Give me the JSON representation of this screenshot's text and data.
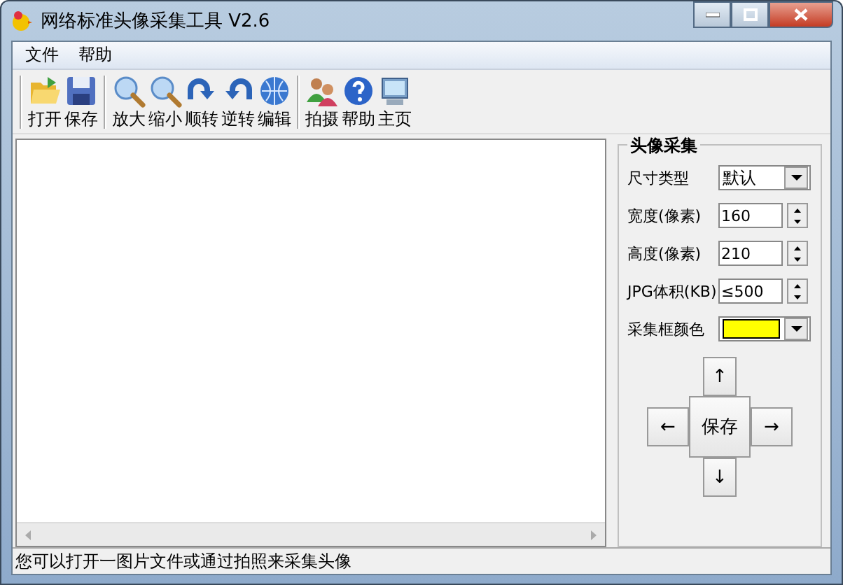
{
  "window": {
    "title": "网络标准头像采集工具 V2.6"
  },
  "menu": [
    "文件",
    "帮助"
  ],
  "toolbar": {
    "groups": [
      [
        {
          "label": "打开"
        },
        {
          "label": "保存"
        }
      ],
      [
        {
          "label": "放大"
        },
        {
          "label": "缩小"
        },
        {
          "label": "顺转"
        },
        {
          "label": "逆转"
        },
        {
          "label": "编辑"
        }
      ],
      [
        {
          "label": "拍摄"
        },
        {
          "label": "帮助"
        },
        {
          "label": "主页"
        }
      ]
    ]
  },
  "panel": {
    "title": "头像采集",
    "rows": [
      {
        "kind": "dropdown",
        "label": "尺寸类型",
        "value": "默认"
      },
      {
        "kind": "spinner",
        "label": "宽度(像素)",
        "value": "160"
      },
      {
        "kind": "spinner",
        "label": "高度(像素)",
        "value": "210"
      },
      {
        "kind": "spinner",
        "label": "JPG体积(KB)",
        "value": "≤500"
      },
      {
        "kind": "color",
        "label": "采集框颜色",
        "color": "#ffff00"
      }
    ],
    "nudge": {
      "up": "↑",
      "left": "←",
      "center": "保存",
      "right": "→",
      "down": "↓"
    }
  },
  "status_bar": "您可以打开一图片文件或通过拍照来采集头像"
}
